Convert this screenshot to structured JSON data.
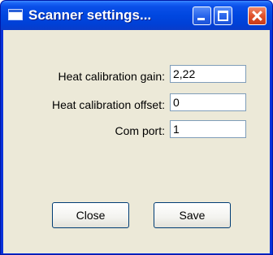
{
  "window": {
    "title": "Scanner settings...",
    "controls": {
      "minimize": "minimize-icon",
      "maximize": "maximize-icon",
      "close": "close-icon"
    }
  },
  "form": {
    "fields": [
      {
        "label": "Heat calibration gain:",
        "value": "2,22"
      },
      {
        "label": "Heat calibration offset:",
        "value": "0"
      },
      {
        "label": "Com port:",
        "value": "1"
      }
    ]
  },
  "buttons": {
    "close": "Close",
    "save": "Save"
  },
  "colors": {
    "title_bar": "#0047e0",
    "dialog_background": "#ece9d8",
    "field_border": "#7f9db9"
  }
}
